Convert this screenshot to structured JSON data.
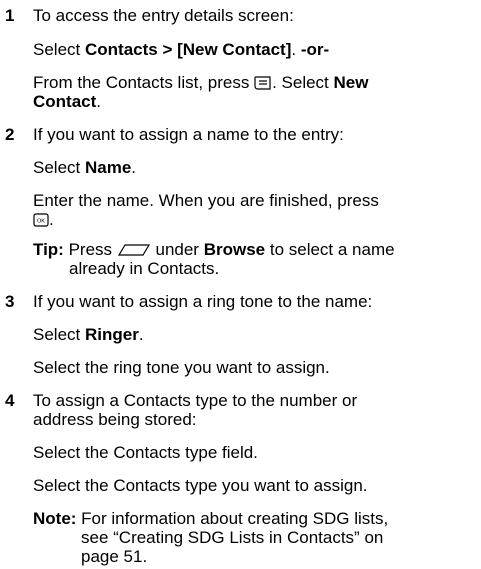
{
  "steps": [
    {
      "number": "1",
      "intro": "To access the entry details screen:",
      "line_a": [
        "Select ",
        "Contacts > [New Contact]",
        ". ",
        "-or-"
      ],
      "line_b": [
        "From the Contacts list, press ",
        ". Select ",
        "New"
      ],
      "line_b2": [
        "Contact",
        "."
      ]
    },
    {
      "number": "2",
      "intro": "If you want to assign a name to the entry:",
      "select": [
        "Select ",
        "Name",
        "."
      ],
      "enter": "Enter the name. When you are finished, press",
      "enter_end": ".",
      "tip_label": "Tip:",
      "tip_a": [
        " Press ",
        " under ",
        "Browse",
        " to select a name"
      ],
      "tip_b": "already in Contacts."
    },
    {
      "number": "3",
      "intro": "If you want to assign a ring tone to the name:",
      "select": [
        "Select ",
        "Ringer",
        "."
      ],
      "after": "Select the ring tone you want to assign."
    },
    {
      "number": "4",
      "intro_a": "To assign a Contacts type to the number or",
      "intro_b": "address being stored:",
      "sel1": "Select the Contacts type field.",
      "sel2": "Select the Contacts type you want to assign.",
      "note_label": "Note:",
      "note_a": " For information about creating SDG lists,",
      "note_b": "see “Creating SDG Lists in Contacts” on",
      "note_c": "page 51."
    }
  ],
  "icons": {
    "menu_key": "menu-key-icon",
    "ok_key": "ok-key-icon",
    "softkey": "softkey-icon"
  }
}
